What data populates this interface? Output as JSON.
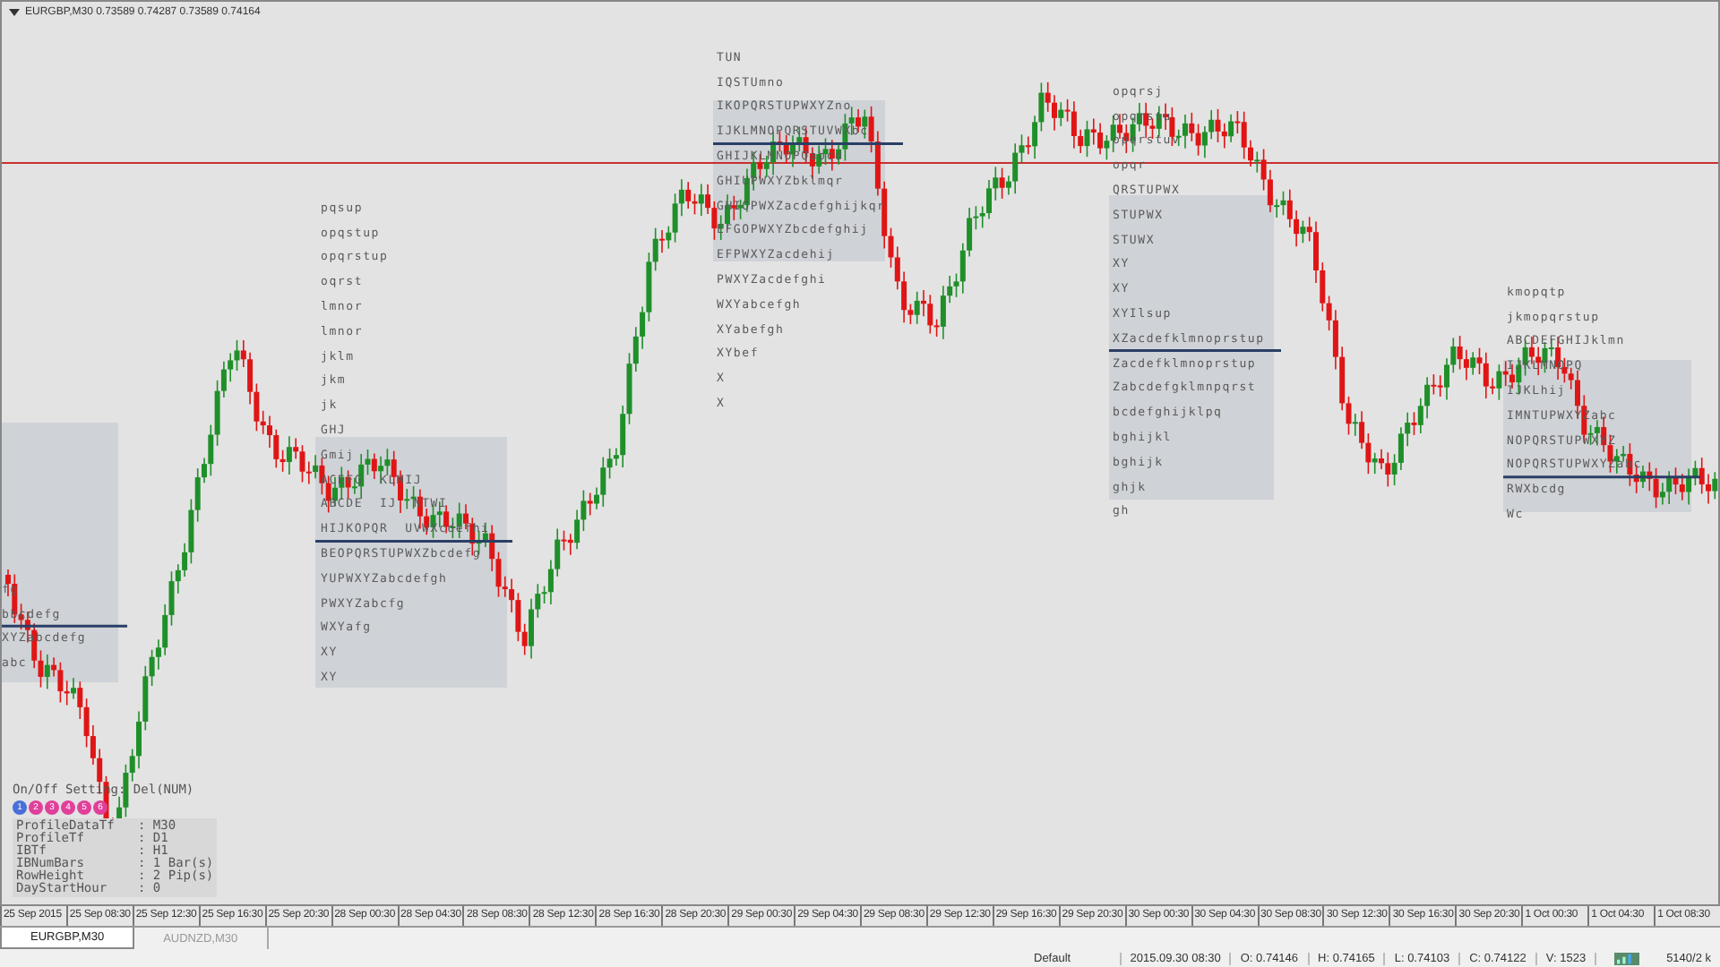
{
  "chart_header": {
    "label": "EURGBP,M30  0.73589 0.74287 0.73589 0.74164"
  },
  "profiles": [
    {
      "rows": [
        "fg",
        "bbcdefg",
        "XYZabcdefg",
        "abc"
      ]
    },
    {
      "rows": [
        "pqsup",
        "opqstup",
        "opqrstup",
        "oqrst",
        "lmnor",
        "lmnor",
        "jklm",
        "jkm",
        "jk",
        "GHJ",
        "Gmij",
        "ACEFG  KLMIJ",
        "ABCDE  IJ  NTWI",
        "HIJKOPQR  UVWXcdefhi",
        "BEOPQRSTUPWXZbcdefg",
        "YUPWXYZabcdefgh",
        "PWXYZabcfg",
        "WXYafg",
        "XY",
        "XY"
      ]
    },
    {
      "rows": [
        "TUN",
        "IQSTUmno",
        "IKOPQRSTUPWXYZno",
        "IJKLMNOPQRSTUVWXbc",
        "GHIJKLMNOPQabcd",
        "GHIUPWXYZbklmqr",
        "GHIOPWXZacdefghijkqr",
        "EFGOPWXYZbcdefghij",
        "EFPWXYZacdehij",
        "PWXYZacdefghi",
        "WXYabcefgh",
        "XYabefgh",
        "XYbef",
        "X",
        "X"
      ]
    },
    {
      "rows": [
        "opqrsj",
        "opqrstu",
        "opqrstuv",
        "opqr",
        "QRSTUPWX",
        "STUPWX",
        "STUWX",
        "XY",
        "XY",
        "XYIlsup",
        "XZacdefklmnoprstup",
        "Zacdefklmnoprstup",
        "Zabcdefgklmnpqrst",
        "bcdefghijklpq",
        "bghijkl",
        "bghijk",
        "ghjk",
        "gh"
      ]
    },
    {
      "rows": [
        "kmopqtp",
        "jkmopqrstup",
        "ABCDEFGHIJklmn",
        "IJKLMNOPQ",
        "IJKLhij",
        "IMNTUPWXYZabc",
        "NOPQRSTUPWXYZ",
        "NOPQRSTUPWXYZabc",
        "RWXbcdg",
        "Wc"
      ]
    }
  ],
  "settings_panel": {
    "toggle_label": "On/Off Setting: Del(NUM)",
    "toggles": [
      {
        "label": "1",
        "color": "#4a6fd8"
      },
      {
        "label": "2",
        "color": "#e0409a"
      },
      {
        "label": "3",
        "color": "#e0409a"
      },
      {
        "label": "4",
        "color": "#e0409a"
      },
      {
        "label": "5",
        "color": "#e0409a"
      },
      {
        "label": "6",
        "color": "#e0409a"
      }
    ],
    "rows": [
      {
        "key": "ProfileDataTf",
        "value": ": M30"
      },
      {
        "key": "ProfileTf",
        "value": ": D1"
      },
      {
        "key": "IBTf",
        "value": ": H1"
      },
      {
        "key": "IBNumBars",
        "value": ": 1 Bar(s)"
      },
      {
        "key": "RowHeight",
        "value": ": 2 Pip(s)"
      },
      {
        "key": "DayStartHour",
        "value": ": 0"
      }
    ]
  },
  "time_axis": [
    "25 Sep 2015",
    "25 Sep 08:30",
    "25 Sep 12:30",
    "25 Sep 16:30",
    "25 Sep 20:30",
    "28 Sep 00:30",
    "28 Sep 04:30",
    "28 Sep 08:30",
    "28 Sep 12:30",
    "28 Sep 16:30",
    "28 Sep 20:30",
    "29 Sep 00:30",
    "29 Sep 04:30",
    "29 Sep 08:30",
    "29 Sep 12:30",
    "29 Sep 16:30",
    "29 Sep 20:30",
    "30 Sep 00:30",
    "30 Sep 04:30",
    "30 Sep 08:30",
    "30 Sep 12:30",
    "30 Sep 16:30",
    "30 Sep 20:30",
    "1 Oct 00:30",
    "1 Oct 04:30",
    "1 Oct 08:30"
  ],
  "tabs": [
    {
      "label": "EURGBP,M30",
      "selected": true
    },
    {
      "label": "AUDNZD,M30",
      "selected": false
    }
  ],
  "status_bar": {
    "profile": "Default",
    "time": "2015.09.30 08:30",
    "open": "O: 0.74146",
    "high": "H: 0.74165",
    "low": "L: 0.74103",
    "close": "C: 0.74122",
    "volume": "V: 1523",
    "traffic": "5140/2 k"
  }
}
